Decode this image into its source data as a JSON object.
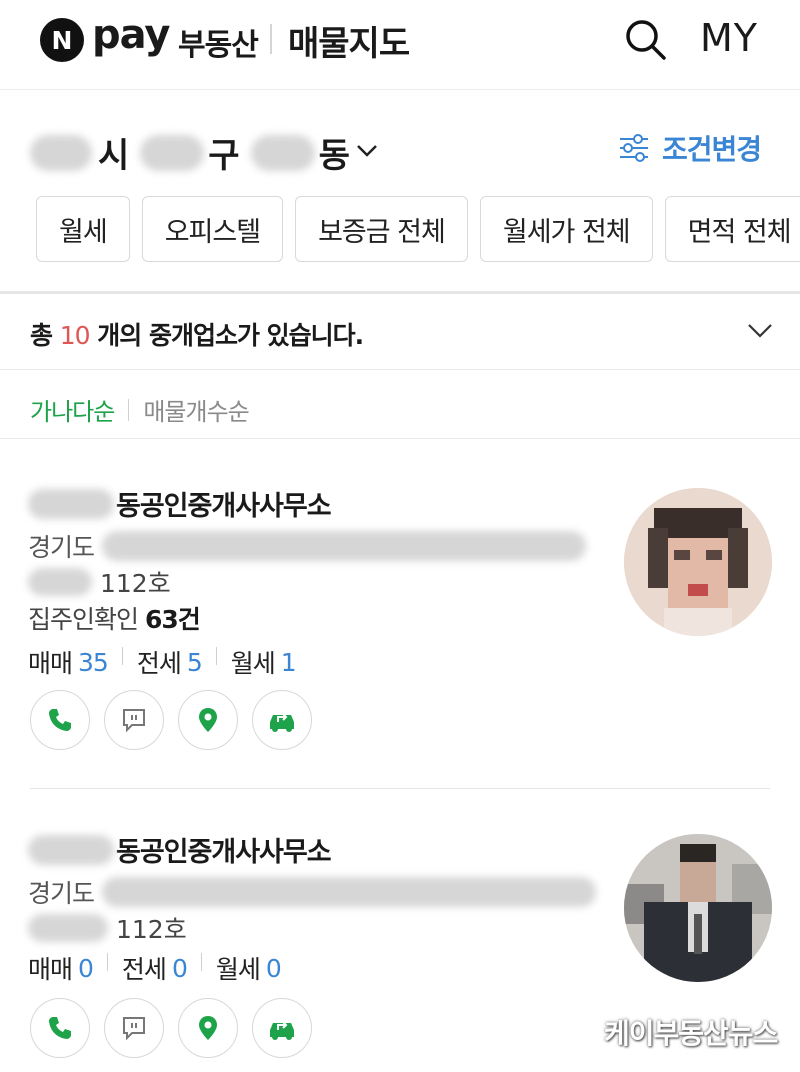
{
  "header": {
    "logo_n": "N",
    "logo_pay": "pay",
    "logo_realestate": "부동산",
    "title": "매물지도",
    "my_label": "MY",
    "search_icon": "search-icon"
  },
  "location": {
    "city_suffix": "시",
    "district_suffix": "구",
    "dong_suffix": "동",
    "condition_label": "조건변경"
  },
  "filters": [
    "월세",
    "오피스텔",
    "보증금 전체",
    "월세가 전체",
    "면적 전체"
  ],
  "summary": {
    "prefix": "총",
    "count": "10",
    "suffix": "개의 중개업소가 있습니다."
  },
  "sort": {
    "active": "가나다순",
    "inactive": "매물개수순"
  },
  "offices": [
    {
      "name_suffix": "동공인중개사사무소",
      "address_prefix": "경기도",
      "unit": "112호",
      "verify_label": "집주인확인",
      "verify_count": "63건",
      "stats": [
        {
          "label": "매매",
          "value": "35"
        },
        {
          "label": "전세",
          "value": "5"
        },
        {
          "label": "월세",
          "value": "1"
        }
      ]
    },
    {
      "name_suffix": "동공인중개사사무소",
      "address_prefix": "경기도",
      "unit": "112호",
      "stats": [
        {
          "label": "매매",
          "value": "0"
        },
        {
          "label": "전세",
          "value": "0"
        },
        {
          "label": "월세",
          "value": "0"
        }
      ]
    }
  ],
  "watermark": "케이부동산뉴스",
  "colors": {
    "accent_green": "#1ea34a",
    "link_blue": "#3b86d4",
    "count_red": "#e05555"
  }
}
